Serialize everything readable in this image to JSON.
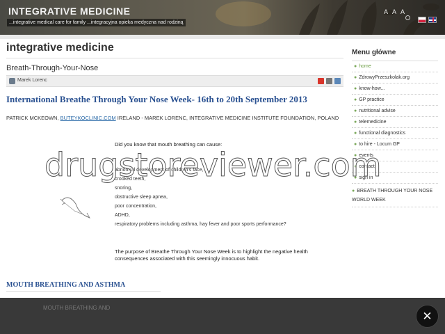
{
  "header": {
    "site_title": "INTEGRATIVE MEDICINE",
    "tagline": "...integrative medical care for family ...integracyjna opieka medyczna nad rodziną",
    "font_controls": [
      "A",
      "A",
      "A"
    ],
    "languages": [
      "Polski",
      "English"
    ]
  },
  "main": {
    "section_title": "integrative medicine",
    "category": "Breath-Through-Your-Nose",
    "author": "Marek Lorenc",
    "article_title": "International Breathe Through Your Nose Week- 16th to 20th September 2013",
    "byline_before": "PATRICK MCKEOWN, ",
    "byline_link": "BUTEYKOCLINIC.COM",
    "byline_after": " IRELAND - MAREK LORENC, INTEGRATIVE MEDICINE INSTITUTE FOUNDATION, POLAND",
    "question": "Did you know that mouth breathing can cause:",
    "list": [
      "abnormal development of children's face,",
      "crooked teeth,",
      "snoring,",
      "obstructive sleep apnea,",
      "poor concentration,",
      "ADHD,",
      "respiratory problems including asthma, hay fever and poor sports performance?"
    ],
    "purpose": "The purpose of Breathe Through Your Nose Week is to highlight the negative health consequences associated with this seemingly innocuous habit.",
    "sub_heading": "MOUTH BREATHING AND ASTHMA"
  },
  "sidebar": {
    "title": "Menu główne",
    "items": [
      "home",
      "ZdrowyPrzeszkolak.org",
      "know-how...",
      "GP practice",
      "nutritional advise",
      "telemedicine",
      "functional diagnostics",
      "to hire - Locum GP",
      "events",
      "contact",
      "sign in"
    ],
    "extra_item": "BREATH THROUGH YOUR NOSE WORLD WEEK"
  },
  "watermark": "drugstoreviewer.com",
  "footer": {
    "text": "MOUTH BREATHING AND",
    "close_label": "✕"
  },
  "colors": {
    "accent_blue": "#2a5191",
    "active_green": "#6b9d43"
  }
}
